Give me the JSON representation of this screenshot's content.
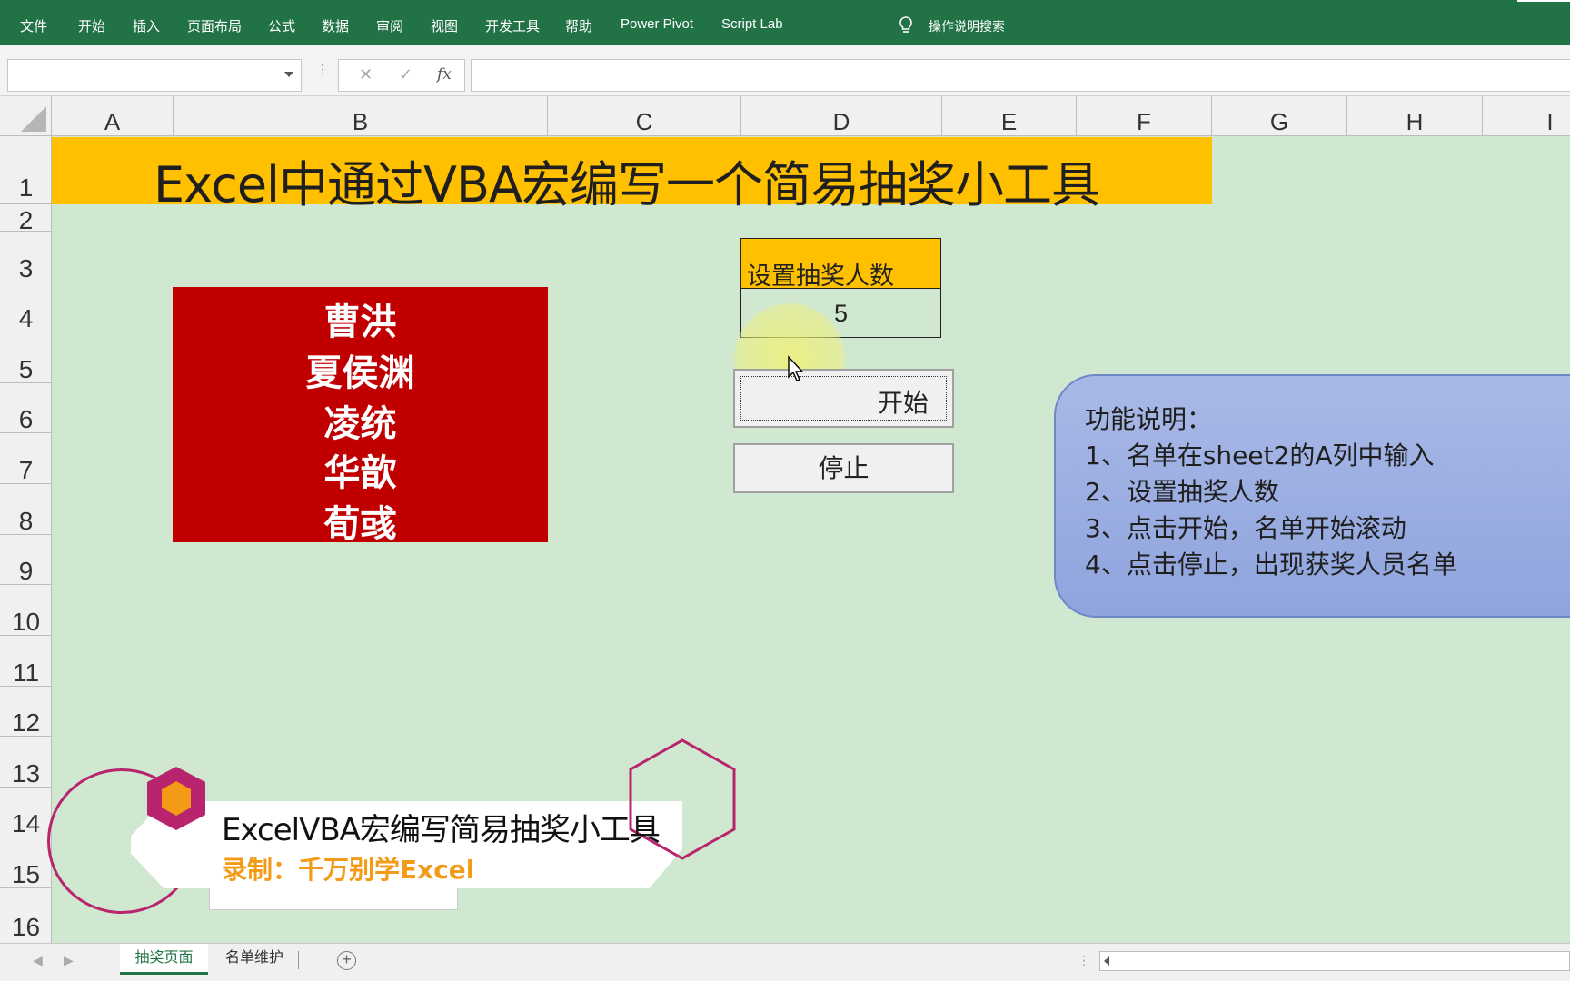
{
  "ribbon": {
    "tabs": [
      "文件",
      "开始",
      "插入",
      "页面布局",
      "公式",
      "数据",
      "审阅",
      "视图",
      "开发工具",
      "帮助",
      "Power Pivot",
      "Script Lab"
    ],
    "tell_me": "操作说明搜索"
  },
  "formula_bar": {
    "name_box": "",
    "cancel_icon": "✕",
    "enter_icon": "✓",
    "fx_label": "fx",
    "formula": ""
  },
  "columns": [
    "A",
    "B",
    "C",
    "D",
    "E",
    "F",
    "G",
    "H",
    "I"
  ],
  "rows": [
    "1",
    "2",
    "3",
    "4",
    "5",
    "6",
    "7",
    "8",
    "9",
    "10",
    "11",
    "12",
    "13",
    "14",
    "15",
    "16"
  ],
  "sheet": {
    "title": "Excel中通过VBA宏编写一个简易抽奖小工具",
    "winners": [
      "曹洪",
      "夏侯渊",
      "凌统",
      "华歆",
      "荀彧"
    ],
    "count_label": "设置抽奖人数",
    "count_value": "5",
    "start_button": "开始",
    "stop_button": "停止",
    "info": {
      "heading": "功能说明：",
      "lines": [
        "1、名单在sheet2的A列中输入",
        "2、设置抽奖人数",
        "3、点击开始，名单开始滚动",
        "4、点击停止，出现获奖人员名单"
      ]
    }
  },
  "watermark": {
    "title": "ExcelVBA宏编写简易抽奖小工具",
    "subtitle": "录制：千万别学Excel"
  },
  "sheet_tabs": [
    "抽奖页面",
    "名单维护"
  ],
  "colors": {
    "ribbon": "#217346",
    "sheet_bg": "#cfe8cf",
    "title_bg": "#ffc000",
    "winners_bg": "#c00000",
    "info_bg": "#8fa4de",
    "watermark_accent": "#f39a16"
  }
}
